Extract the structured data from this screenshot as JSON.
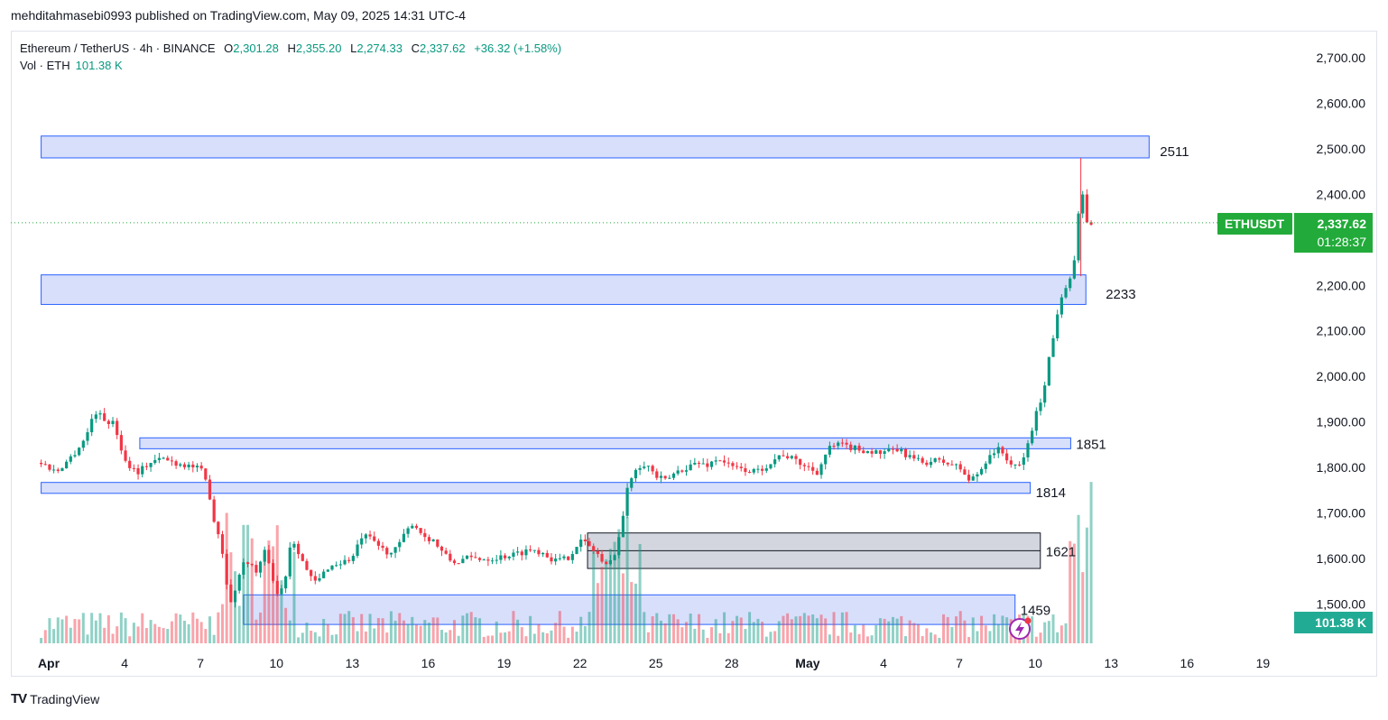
{
  "header": {
    "publisher_line": "mehditahmasebi0993 published on TradingView.com, May 09, 2025 14:31 UTC-4"
  },
  "legend": {
    "symbol": "Ethereum / TetherUS · 4h · BINANCE",
    "open_label": "O",
    "open": "2,301.28",
    "high_label": "H",
    "high": "2,355.20",
    "low_label": "L",
    "low": "2,274.33",
    "close_label": "C",
    "close": "2,337.62",
    "change": "+36.32 (+1.58%)",
    "volume_label": "Vol · ETH",
    "volume": "101.38 K"
  },
  "badges": {
    "ticker": "ETHUSDT",
    "price": "2,337.62",
    "countdown": "01:28:37",
    "volume": "101.38 K"
  },
  "colors": {
    "up": "#089981",
    "down": "#f23645",
    "zone_fill": "#d4dcfb",
    "zone_stroke": "#2962ff",
    "gray_fill": "#d1d4dc",
    "badge": "#22ab3a",
    "vol_badge": "#22ab94"
  },
  "chart_data": {
    "type": "candlestick",
    "symbol": "ETHUSDT",
    "timeframe": "4h",
    "ylim": [
      1450,
      2760
    ],
    "y_ticks": [
      "2,700.00",
      "2,600.00",
      "2,500.00",
      "2,400.00",
      "2,300.00",
      "2,200.00",
      "2,100.00",
      "2,000.00",
      "1,900.00",
      "1,800.00",
      "1,700.00",
      "1,600.00",
      "1,500.00"
    ],
    "y_tick_values": [
      2700,
      2600,
      2500,
      2400,
      2300,
      2200,
      2100,
      2000,
      1900,
      1800,
      1700,
      1600,
      1500
    ],
    "x_ticks": [
      "Apr",
      "4",
      "7",
      "10",
      "13",
      "16",
      "19",
      "22",
      "25",
      "28",
      "May",
      "4",
      "7",
      "10",
      "13",
      "16",
      "19"
    ],
    "x_tick_days": [
      0,
      3,
      6,
      9,
      12,
      15,
      18,
      21,
      24,
      27,
      30,
      33,
      36,
      39,
      42,
      45,
      48
    ],
    "last_price": 2337.62,
    "zones": [
      {
        "label": "2511",
        "low": 2480,
        "high": 2528,
        "start_day": -0.3,
        "end_day": 43.5,
        "style": "blue"
      },
      {
        "label": "2233",
        "low": 2158,
        "high": 2223,
        "start_day": -0.3,
        "end_day": 41.0,
        "style": "blue"
      },
      {
        "label": "1851",
        "low": 1841,
        "high": 1865,
        "start_day": 3.6,
        "end_day": 40.4,
        "style": "blue"
      },
      {
        "label": "1814",
        "low": 1743,
        "high": 1767,
        "start_day": -0.3,
        "end_day": 38.8,
        "style": "blue"
      },
      {
        "label": "1621",
        "low": 1578,
        "high": 1656,
        "start_day": 21.3,
        "end_day": 39.2,
        "style": "gray",
        "mid": 1617
      },
      {
        "label": "1459",
        "low": 1455,
        "high": 1520,
        "start_day": 7.7,
        "end_day": 38.2,
        "style": "blue"
      }
    ],
    "price_path": [
      [
        -0.3,
        1810
      ],
      [
        0.3,
        1790
      ],
      [
        1.0,
        1830
      ],
      [
        1.5,
        1870
      ],
      [
        1.8,
        1925
      ],
      [
        2.2,
        1905
      ],
      [
        2.6,
        1895
      ],
      [
        3.0,
        1815
      ],
      [
        3.5,
        1790
      ],
      [
        4.0,
        1810
      ],
      [
        4.5,
        1820
      ],
      [
        5.0,
        1810
      ],
      [
        5.5,
        1805
      ],
      [
        6.0,
        1795
      ],
      [
        6.3,
        1760
      ],
      [
        6.5,
        1690
      ],
      [
        6.8,
        1640
      ],
      [
        7.0,
        1560
      ],
      [
        7.2,
        1500
      ],
      [
        7.5,
        1560
      ],
      [
        7.8,
        1600
      ],
      [
        8.2,
        1570
      ],
      [
        8.6,
        1620
      ],
      [
        9.0,
        1520
      ],
      [
        9.3,
        1540
      ],
      [
        9.6,
        1650
      ],
      [
        10.0,
        1600
      ],
      [
        10.3,
        1560
      ],
      [
        10.6,
        1545
      ],
      [
        11.0,
        1580
      ],
      [
        11.5,
        1590
      ],
      [
        12.0,
        1600
      ],
      [
        12.4,
        1650
      ],
      [
        12.8,
        1640
      ],
      [
        13.2,
        1620
      ],
      [
        13.6,
        1610
      ],
      [
        14.0,
        1645
      ],
      [
        14.4,
        1680
      ],
      [
        14.8,
        1650
      ],
      [
        15.2,
        1640
      ],
      [
        15.6,
        1610
      ],
      [
        16.0,
        1590
      ],
      [
        16.5,
        1600
      ],
      [
        17.0,
        1600
      ],
      [
        17.5,
        1600
      ],
      [
        18.0,
        1605
      ],
      [
        18.5,
        1610
      ],
      [
        19.0,
        1620
      ],
      [
        19.5,
        1615
      ],
      [
        20.0,
        1595
      ],
      [
        20.5,
        1600
      ],
      [
        21.0,
        1640
      ],
      [
        21.3,
        1630
      ],
      [
        21.7,
        1610
      ],
      [
        22.0,
        1580
      ],
      [
        22.3,
        1600
      ],
      [
        22.6,
        1660
      ],
      [
        22.9,
        1760
      ],
      [
        23.2,
        1800
      ],
      [
        23.6,
        1810
      ],
      [
        24.0,
        1780
      ],
      [
        24.4,
        1770
      ],
      [
        24.8,
        1790
      ],
      [
        25.2,
        1800
      ],
      [
        25.6,
        1810
      ],
      [
        26.0,
        1805
      ],
      [
        26.5,
        1820
      ],
      [
        27.0,
        1800
      ],
      [
        27.5,
        1795
      ],
      [
        28.0,
        1790
      ],
      [
        28.5,
        1810
      ],
      [
        29.0,
        1830
      ],
      [
        29.5,
        1815
      ],
      [
        30.0,
        1800
      ],
      [
        30.4,
        1790
      ],
      [
        30.8,
        1840
      ],
      [
        31.2,
        1850
      ],
      [
        31.6,
        1845
      ],
      [
        32.0,
        1840
      ],
      [
        32.5,
        1835
      ],
      [
        33.0,
        1830
      ],
      [
        33.5,
        1840
      ],
      [
        34.0,
        1825
      ],
      [
        34.5,
        1810
      ],
      [
        35.0,
        1815
      ],
      [
        35.5,
        1810
      ],
      [
        36.0,
        1800
      ],
      [
        36.4,
        1770
      ],
      [
        36.8,
        1790
      ],
      [
        37.2,
        1830
      ],
      [
        37.6,
        1840
      ],
      [
        38.0,
        1810
      ],
      [
        38.3,
        1795
      ],
      [
        38.6,
        1830
      ],
      [
        38.9,
        1890
      ],
      [
        39.1,
        1930
      ],
      [
        39.3,
        1960
      ],
      [
        39.5,
        2030
      ],
      [
        39.7,
        2080
      ],
      [
        39.9,
        2150
      ],
      [
        40.1,
        2190
      ],
      [
        40.3,
        2210
      ],
      [
        40.5,
        2230
      ],
      [
        40.7,
        2350
      ],
      [
        40.9,
        2400
      ],
      [
        41.1,
        2320
      ],
      [
        41.3,
        2337
      ]
    ],
    "highlight_wick": {
      "day": 40.8,
      "high": 2480,
      "low": 2220
    }
  }
}
